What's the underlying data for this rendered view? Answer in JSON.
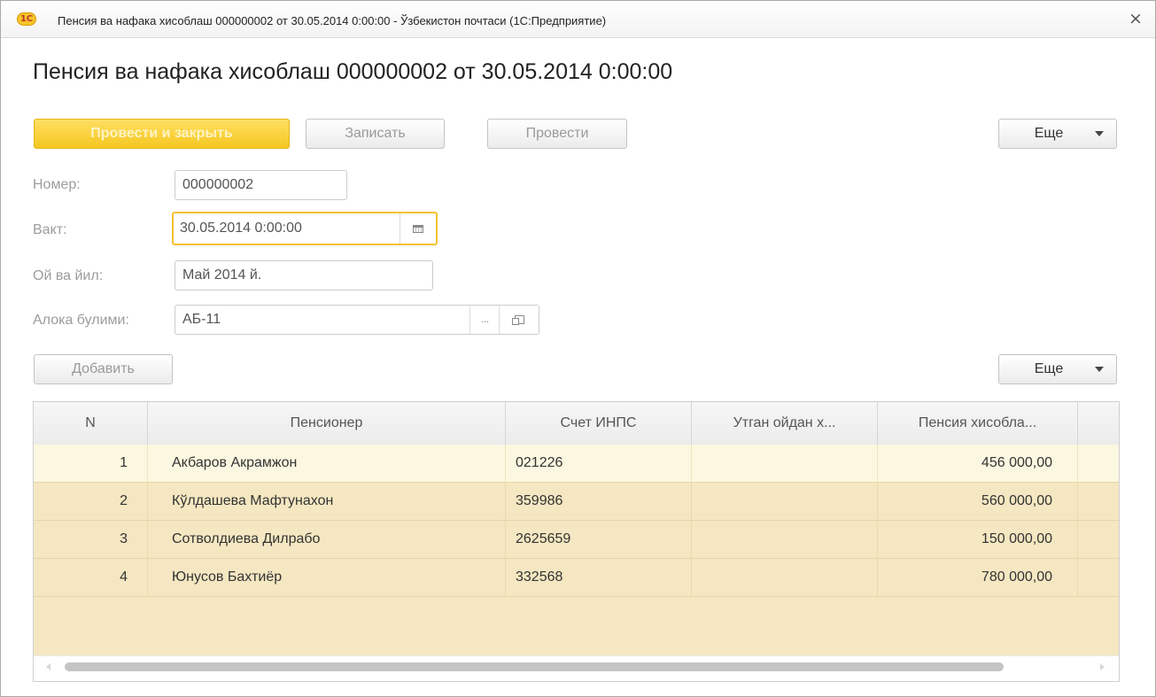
{
  "window": {
    "app_icon_text": "1С",
    "title": "Пенсия ва нафака хисоблаш 000000002 от 30.05.2014 0:00:00 - Ўзбекистон почтаси  (1С:Предприятие)",
    "close_glyph": "×"
  },
  "form": {
    "heading": "Пенсия ва нафака хисоблаш 000000002 от 30.05.2014 0:00:00"
  },
  "toolbar": {
    "post_close_label": "Провести и закрыть",
    "save_label": "Записать",
    "post_label": "Провести",
    "more_label": "Еще"
  },
  "fields": {
    "number": {
      "label": "Номер:",
      "value": "000000002"
    },
    "date": {
      "label": "Вакт:",
      "value": "30.05.2014  0:00:00"
    },
    "period": {
      "label": "Ой ва йил:",
      "value": "Май 2014 й."
    },
    "department": {
      "label": "Алока булими:",
      "value": "АБ-11",
      "select_glyph": "..."
    }
  },
  "table_toolbar": {
    "add_label": "Добавить",
    "more_label": "Еще"
  },
  "table": {
    "columns": [
      "N",
      "Пенсионер",
      "Счет ИНПС",
      "Утган ойдан х...",
      "Пенсия хисобла..."
    ],
    "rows": [
      {
        "n": "1",
        "pensioner": "Акбаров Акрамжон",
        "account": "021226",
        "prev": "",
        "amount": "456 000,00"
      },
      {
        "n": "2",
        "pensioner": "Кўлдашева Мафтунахон",
        "account": "359986",
        "prev": "",
        "amount": "560 000,00"
      },
      {
        "n": "3",
        "pensioner": "Сотволдиева Дилрабо",
        "account": "2625659",
        "prev": "",
        "amount": "150 000,00"
      },
      {
        "n": "4",
        "pensioner": "Юнусов Бахтиёр",
        "account": "332568",
        "prev": "",
        "amount": "780 000,00"
      }
    ],
    "selected_row": 1
  },
  "colors": {
    "primary_button": "#f5c720",
    "focus_border": "#f1c232",
    "table_background": "#f4e7c1",
    "selected_row": "#fcf7e0"
  }
}
